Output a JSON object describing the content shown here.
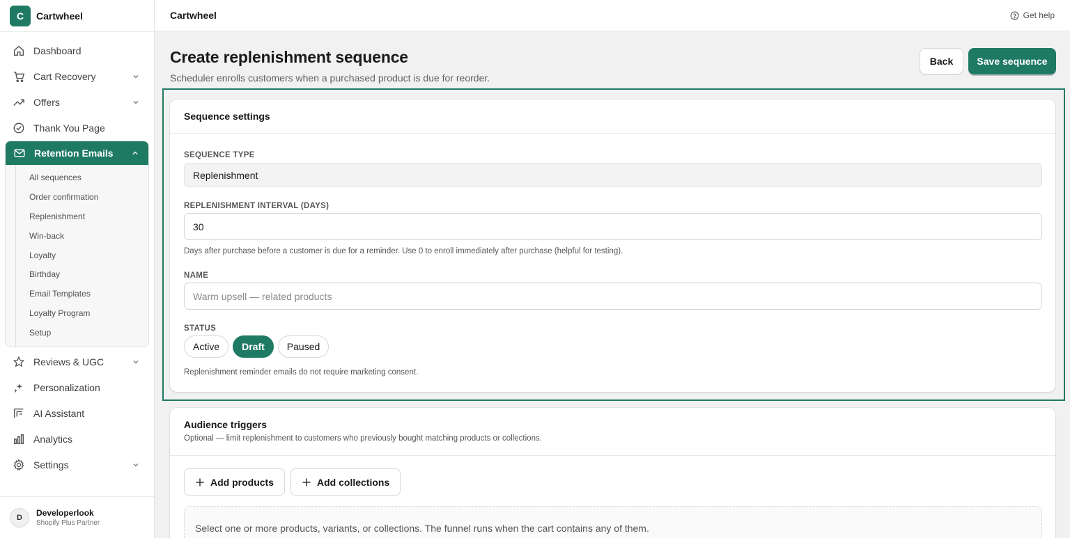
{
  "brand": {
    "logo_letter": "C",
    "name": "Cartwheel"
  },
  "sidebar": {
    "items": [
      {
        "label": "Dashboard",
        "icon": "home-icon"
      },
      {
        "label": "Cart Recovery",
        "icon": "cart-icon"
      },
      {
        "label": "Offers",
        "icon": "trend-up-icon"
      },
      {
        "label": "Thank You Page",
        "icon": "check-circle-icon"
      },
      {
        "label": "Retention Emails",
        "icon": "mail-icon"
      },
      {
        "label": "Reviews & UGC",
        "icon": "star-icon"
      },
      {
        "label": "Personalization",
        "icon": "sparkle-icon"
      },
      {
        "label": "AI Assistant",
        "icon": "ai-icon"
      },
      {
        "label": "Analytics",
        "icon": "bar-chart-icon"
      },
      {
        "label": "Settings",
        "icon": "gear-icon"
      }
    ],
    "sub_items": [
      "All sequences",
      "Order confirmation",
      "Replenishment",
      "Win-back",
      "Loyalty",
      "Birthday",
      "Email Templates",
      "Loyalty Program",
      "Setup"
    ]
  },
  "user": {
    "initial": "D",
    "name": "Developerlook",
    "role": "Shopify Plus Partner"
  },
  "topbar": {
    "title": "Cartwheel",
    "help": "Get help"
  },
  "page": {
    "title": "Create replenishment sequence",
    "subtitle": "Scheduler enrolls customers when a purchased product is due for reorder.",
    "back_label": "Back",
    "save_label": "Save sequence"
  },
  "settings": {
    "title": "Sequence settings",
    "type_label": "SEQUENCE TYPE",
    "type_value": "Replenishment",
    "interval_label": "REPLENISHMENT INTERVAL (DAYS)",
    "interval_value": "30",
    "interval_help": "Days after purchase before a customer is due for a reminder. Use 0 to enroll immediately after purchase (helpful for testing).",
    "name_label": "NAME",
    "name_placeholder": "Warm upsell — related products",
    "status_label": "STATUS",
    "status_options": [
      "Active",
      "Draft",
      "Paused"
    ],
    "status_selected": "Draft",
    "status_help": "Replenishment reminder emails do not require marketing consent."
  },
  "audience": {
    "title": "Audience triggers",
    "subtitle": "Optional — limit replenishment to customers who previously bought matching products or collections.",
    "add_products": "Add products",
    "add_collections": "Add collections",
    "empty_text": "Select one or more products, variants, or collections. The funnel runs when the cart contains any of them."
  },
  "colors": {
    "accent": "#1f7a63",
    "background": "#f1f1f1"
  }
}
